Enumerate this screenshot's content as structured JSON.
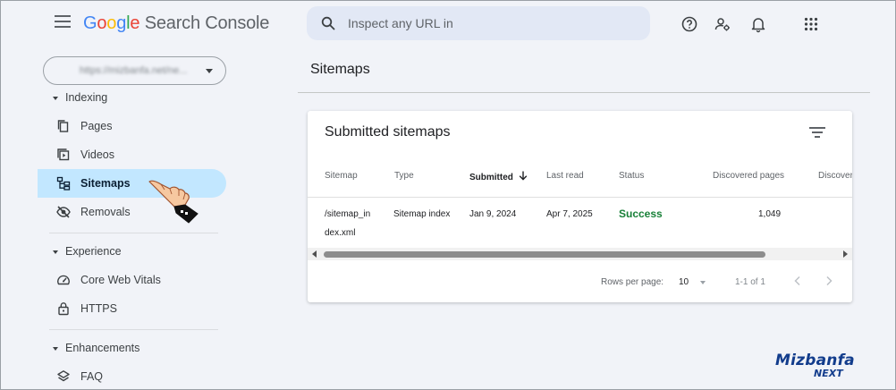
{
  "app": {
    "logo_parts": [
      "G",
      "o",
      "o",
      "g",
      "l",
      "e"
    ],
    "product": "Search Console",
    "search_placeholder": "Inspect any URL in"
  },
  "icons": {
    "menu": "hamburger-menu-icon",
    "search": "search-icon",
    "help": "help-icon",
    "users": "manage-users-icon",
    "notifications": "bell-icon",
    "apps": "apps-grid-icon"
  },
  "property": {
    "value": "https://mizbanfa.net/ne..."
  },
  "sidebar": {
    "sections": [
      {
        "label": "Indexing"
      },
      {
        "label": "Experience"
      },
      {
        "label": "Enhancements"
      }
    ],
    "items": [
      {
        "label": "Pages",
        "icon": "pages-icon"
      },
      {
        "label": "Videos",
        "icon": "videos-icon"
      },
      {
        "label": "Sitemaps",
        "icon": "sitemaps-icon",
        "active": true
      },
      {
        "label": "Removals",
        "icon": "removals-icon"
      },
      {
        "label": "Core Web Vitals",
        "icon": "speed-gauge-icon"
      },
      {
        "label": "HTTPS",
        "icon": "lock-icon"
      },
      {
        "label": "FAQ",
        "icon": "layers-icon"
      }
    ]
  },
  "main": {
    "title": "Sitemaps",
    "card": {
      "title": "Submitted sitemaps",
      "columns": [
        "Sitemap",
        "Type",
        "Submitted",
        "Last read",
        "Status",
        "Discovered pages",
        "Discover"
      ],
      "sorted_column": "Submitted",
      "rows": [
        {
          "sitemap_line1": "/sitemap_in",
          "sitemap_line2": "dex.xml",
          "type": "Sitemap index",
          "submitted": "Jan 9, 2024",
          "last_read": "Apr 7, 2025",
          "status": "Success",
          "discovered_pages": "1,049"
        }
      ],
      "pagination": {
        "rows_per_page_label": "Rows per page:",
        "rows_per_page": "10",
        "range": "1-1 of 1"
      }
    }
  },
  "watermark": {
    "line1": "Mizbanfa",
    "line2": "NEXT"
  },
  "colors": {
    "background": "#f1f3f8",
    "active_nav": "#c2e7ff",
    "success": "#188038",
    "search_bg": "#e2e8f5"
  }
}
